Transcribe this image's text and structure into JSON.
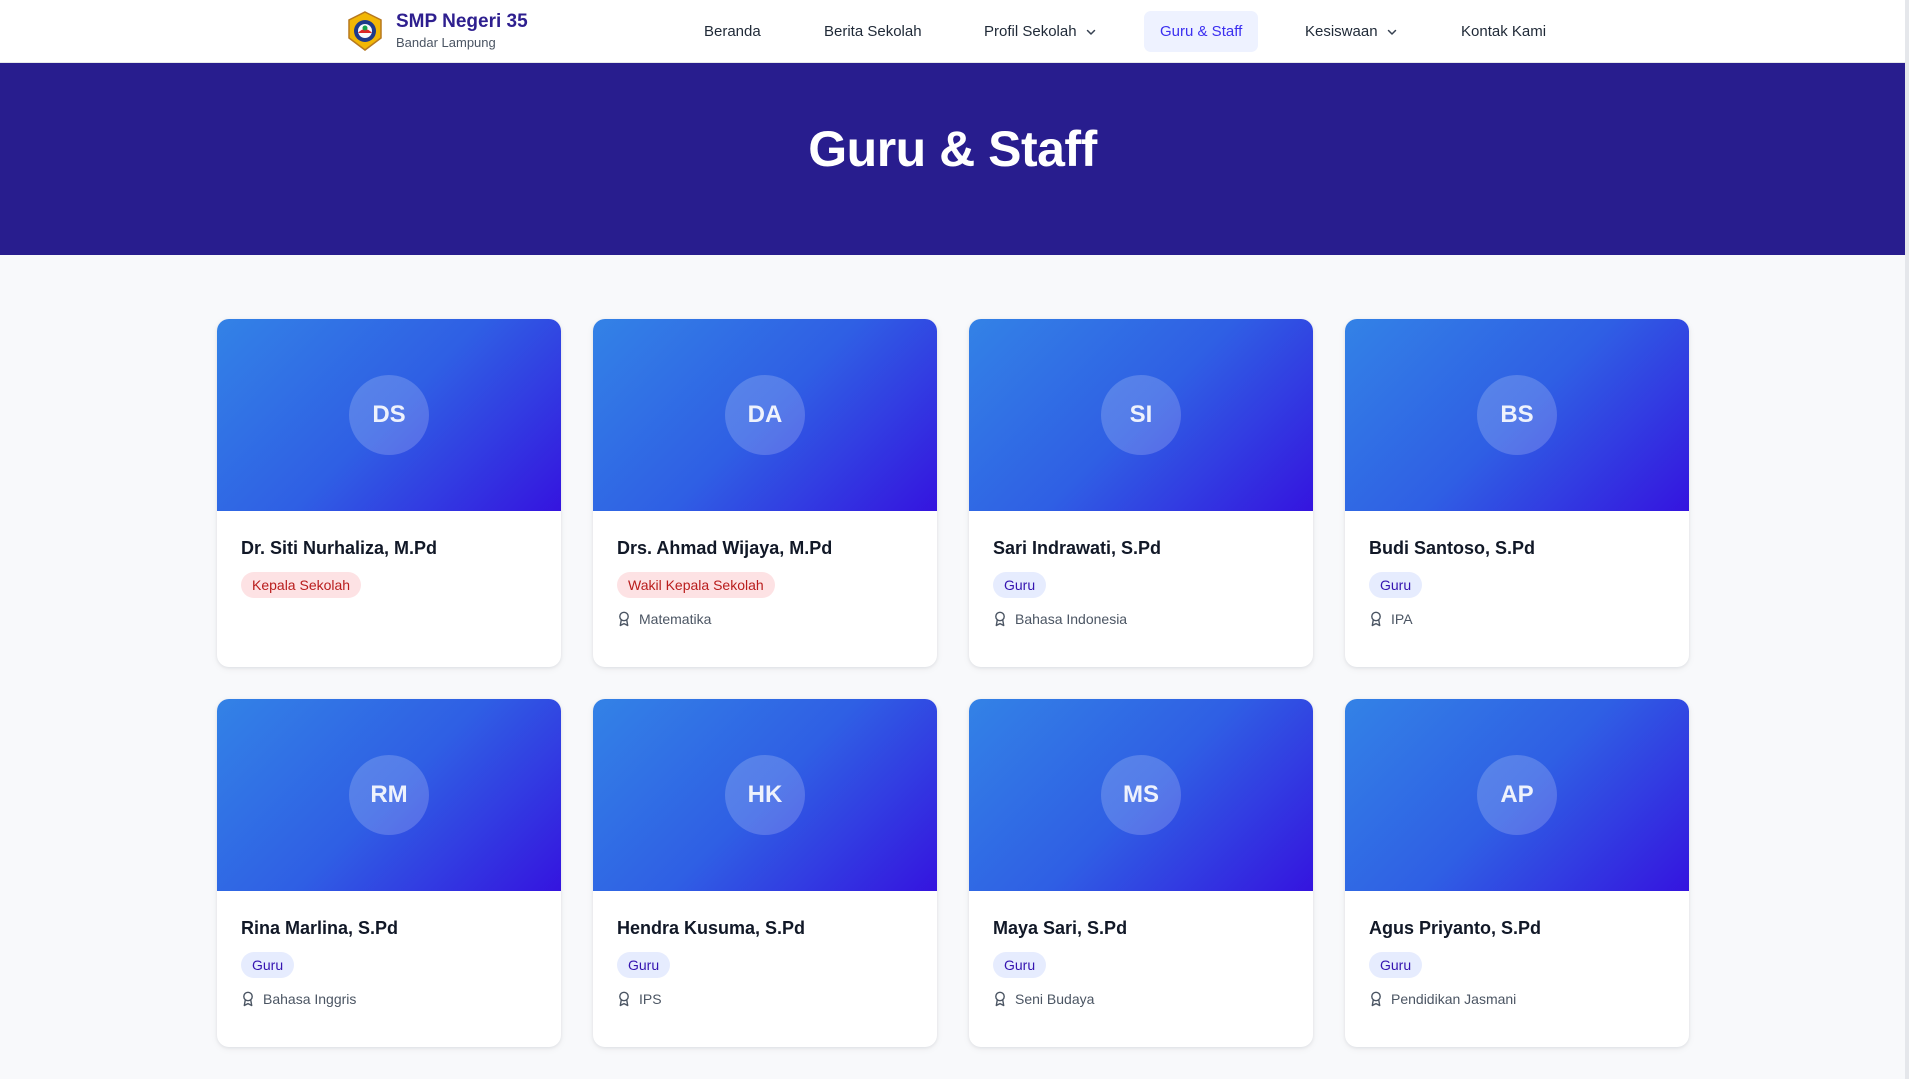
{
  "brand": {
    "title": "SMP Negeri 35",
    "subtitle": "Bandar Lampung"
  },
  "nav": {
    "items": [
      {
        "label": "Beranda"
      },
      {
        "label": "Berita Sekolah"
      },
      {
        "label": "Profil Sekolah",
        "has_dropdown": true
      },
      {
        "label": "Guru & Staff",
        "active": true
      },
      {
        "label": "Kesiswaan",
        "has_dropdown": true
      },
      {
        "label": "Kontak Kami"
      }
    ]
  },
  "hero": {
    "title": "Guru & Staff"
  },
  "colors": {
    "hero_bg": "#281d8e",
    "brand_text": "#2e1f8f",
    "active_nav_bg": "#eef2ff",
    "active_nav_text": "#3b2ff0",
    "card_gradient_start": "#3382e6",
    "card_gradient_end": "#3514df",
    "leader_badge_bg": "#fde2e4",
    "leader_badge_text": "#b91c1c",
    "guru_badge_bg": "#e6ecfe",
    "guru_badge_text": "#3514b0"
  },
  "staff": [
    {
      "initials": "DS",
      "name": "Dr. Siti Nurhaliza, M.Pd",
      "role": "Kepala Sekolah",
      "role_type": "leader",
      "subject": ""
    },
    {
      "initials": "DA",
      "name": "Drs. Ahmad Wijaya, M.Pd",
      "role": "Wakil Kepala Sekolah",
      "role_type": "leader",
      "subject": "Matematika"
    },
    {
      "initials": "SI",
      "name": "Sari Indrawati, S.Pd",
      "role": "Guru",
      "role_type": "guru",
      "subject": "Bahasa Indonesia"
    },
    {
      "initials": "BS",
      "name": "Budi Santoso, S.Pd",
      "role": "Guru",
      "role_type": "guru",
      "subject": "IPA"
    },
    {
      "initials": "RM",
      "name": "Rina Marlina, S.Pd",
      "role": "Guru",
      "role_type": "guru",
      "subject": "Bahasa Inggris"
    },
    {
      "initials": "HK",
      "name": "Hendra Kusuma, S.Pd",
      "role": "Guru",
      "role_type": "guru",
      "subject": "IPS"
    },
    {
      "initials": "MS",
      "name": "Maya Sari, S.Pd",
      "role": "Guru",
      "role_type": "guru",
      "subject": "Seni Budaya"
    },
    {
      "initials": "AP",
      "name": "Agus Priyanto, S.Pd",
      "role": "Guru",
      "role_type": "guru",
      "subject": "Pendidikan Jasmani"
    }
  ]
}
